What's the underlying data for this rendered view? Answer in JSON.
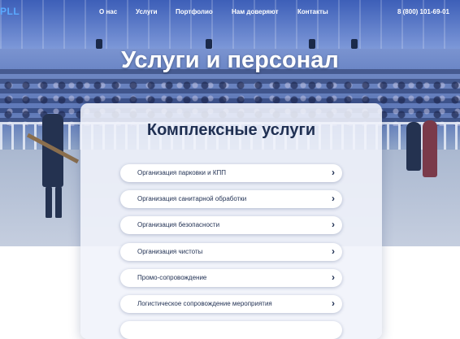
{
  "nav": {
    "logo": "PLL",
    "items": [
      {
        "label": "О нас"
      },
      {
        "label": "Услуги"
      },
      {
        "label": "Портфолио"
      },
      {
        "label": "Нам доверяют"
      },
      {
        "label": "Контакты"
      }
    ],
    "phone": "8 (800) 101-69-01"
  },
  "hero": {
    "title": "Услуги и персонал"
  },
  "card": {
    "title": "Комплексные услуги",
    "services": [
      {
        "label": "Организация парковки и КПП"
      },
      {
        "label": "Организация санитарной обработки"
      },
      {
        "label": "Организация безопасности"
      },
      {
        "label": "Организация чистоты"
      },
      {
        "label": "Промо-сопровождение"
      },
      {
        "label": "Логистическое сопровождение мероприятия"
      }
    ],
    "chevron": "›"
  },
  "colors": {
    "accent": "#5aa9ff",
    "text_dark": "#1f2f52",
    "hero_blue": "#4f6db4"
  }
}
